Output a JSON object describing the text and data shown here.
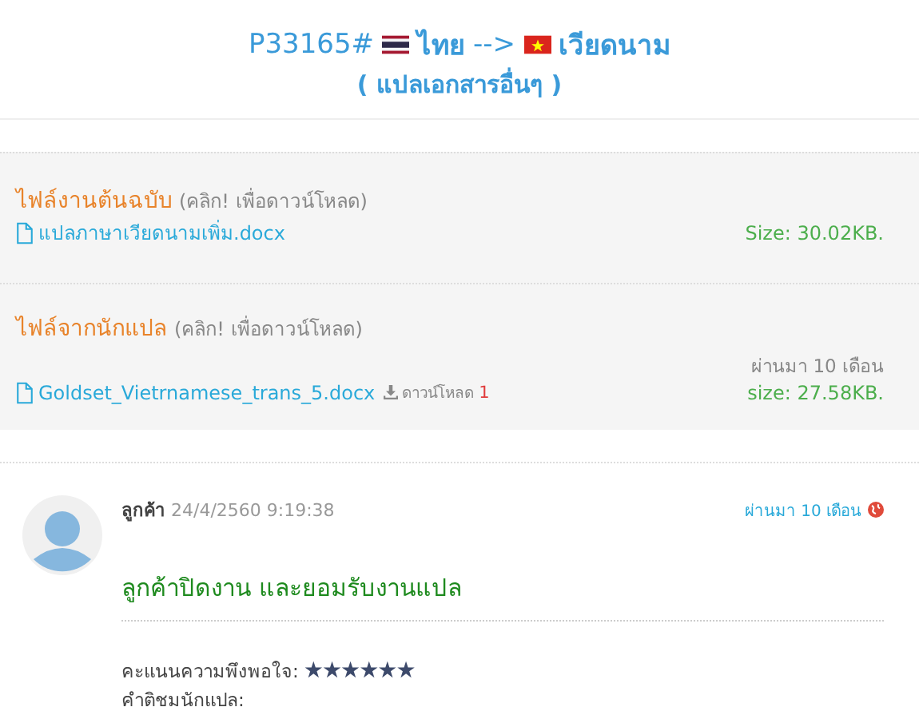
{
  "header": {
    "job_id": "P33165#",
    "source_language": "ไทย",
    "arrow": "-->",
    "target_language": "เวียดนาม",
    "subtitle": "( แปลเอกสารอื่นๆ )"
  },
  "files": [
    {
      "kind": "original",
      "title": "ไฟล์งานต้นฉบับ",
      "hint": "(คลิก! เพื่อดาวน์โหลด)",
      "file_name": "แปลภาษาเวียดนามเพิ่ม.docx",
      "size": "Size: 30.02KB."
    },
    {
      "kind": "translated",
      "title": "ไฟล์จากนักแปล",
      "hint": "(คลิก! เพื่อดาวน์โหลด)",
      "file_name": "Goldset_Vietrnamese_trans_5.docx",
      "download_label": "ดาวน์โหลด",
      "download_count": "1",
      "time_ago": "ผ่านมา 10 เดือน",
      "size": "size: 27.58KB."
    }
  ],
  "comment": {
    "author": "ลูกค้า",
    "timestamp": "24/4/2560 9:19:38",
    "time_ago": "ผ่านมา 10 เดือน",
    "message": "ลูกค้าปิดงาน และยอมรับงานแปล",
    "rating_label": "คะแนนความพึงพอใจ:",
    "stars": 6,
    "review_label": "คำติชมนักแปล:"
  }
}
